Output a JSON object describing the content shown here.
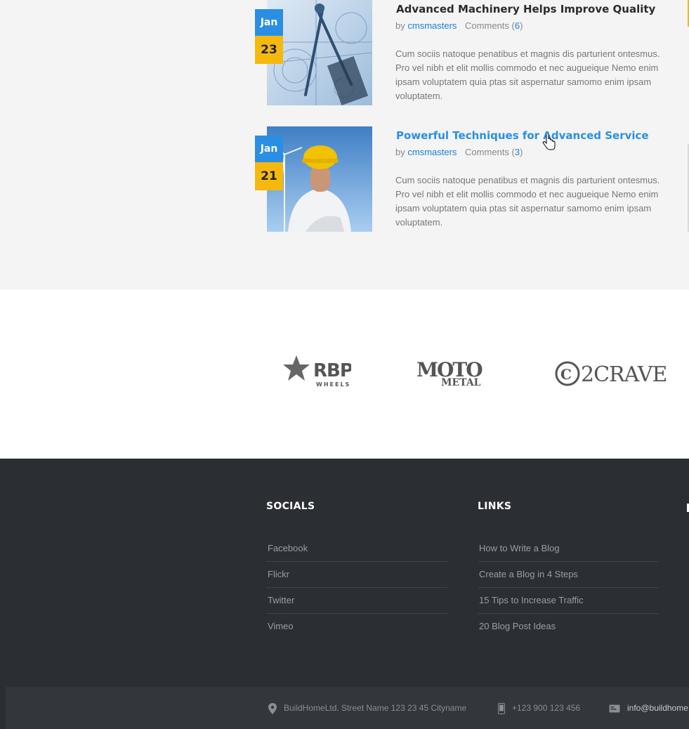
{
  "posts": [
    {
      "month": "Jan",
      "day": "23",
      "title": "Advanced Machinery Helps Improve Quality",
      "by": "by",
      "author": "cmsmasters",
      "comments_label": "Comments (",
      "comments_count": "6",
      "comments_close": ")",
      "excerpt": "Cum sociis natoque penatibus et magnis dis parturient ontesmus. Pro vel nibh et elit mollis commodo et nec augueique Nemo enim ipsam voluptatem quia ptas sit aspernatur samomo enim ipsam voluptatem."
    },
    {
      "month": "Jan",
      "day": "21",
      "title": "Powerful Techniques for Advanced Service",
      "by": "by",
      "author": "cmsmasters",
      "comments_label": "Comments (",
      "comments_count": "3",
      "comments_close": ")",
      "excerpt": "Cum sociis natoque penatibus et magnis dis parturient ontesmus. Pro vel nibh et elit mollis commodo et nec augueique Nemo enim ipsam voluptatem quia ptas sit aspernatur samomo enim ipsam voluptatem."
    }
  ],
  "clients": {
    "logo1": {
      "main": "RBP",
      "sub": "WHEELS"
    },
    "logo2": {
      "main": "MOTO",
      "sub": "METAL"
    },
    "logo3": {
      "main": "2CRAVE"
    }
  },
  "footer": {
    "socials": {
      "title": "SOCIALS",
      "items": [
        "Facebook",
        "Flickr",
        "Twitter",
        "Vimeo"
      ]
    },
    "links": {
      "title": "LINKS",
      "items": [
        "How to Write a Blog",
        "Create a Blog in 4 Steps",
        "15 Tips to Increase Traffic",
        "20 Blog Post Ideas"
      ]
    },
    "contact": {
      "address": "BuildHomeLtd.  Street Name 123  23 45 Cityname",
      "phone": "+123 900 123 456",
      "email": "info@buildhome"
    }
  },
  "colors": {
    "accent_blue": "#2a8fe3",
    "accent_yellow": "#f5b90e",
    "footer_bg": "#2b2e33"
  }
}
